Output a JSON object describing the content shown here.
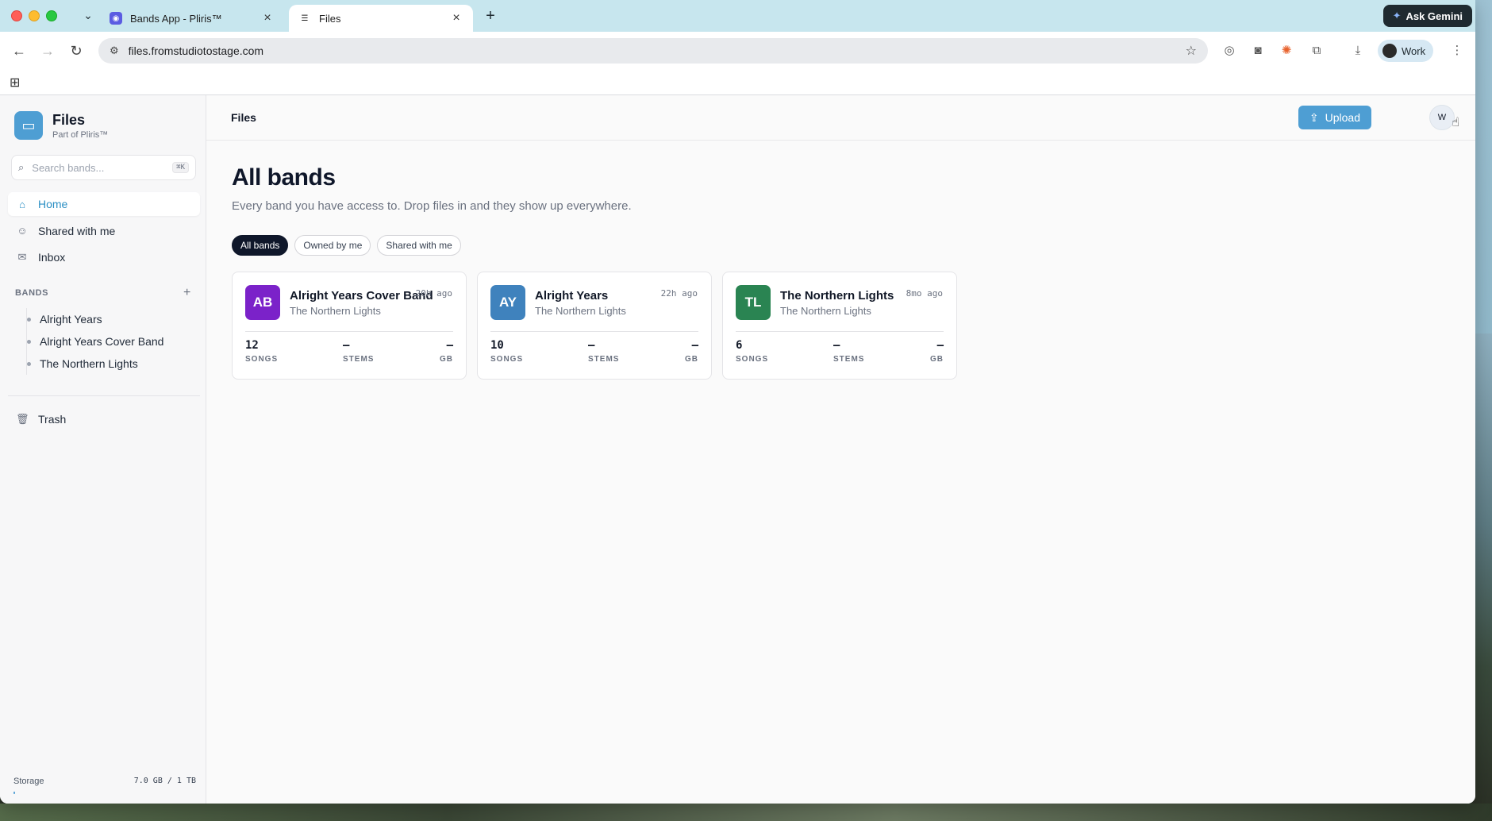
{
  "browser": {
    "tabs": [
      {
        "label": "Bands App - Pliris™"
      },
      {
        "label": "Files"
      }
    ],
    "ask_gemini": "Ask Gemini",
    "url": "files.fromstudiotostage.com",
    "profile": "Work"
  },
  "app": {
    "brand_name": "Files",
    "brand_sub": "Part of Pliris™",
    "search_placeholder": "Search bands...",
    "search_shortcut": "⌘K",
    "nav": [
      {
        "label": "Home"
      },
      {
        "label": "Shared with me"
      },
      {
        "label": "Inbox"
      }
    ],
    "bands_heading": "BANDS",
    "bands": [
      "Alright Years",
      "Alright Years Cover Band",
      "The Northern Lights"
    ],
    "trash": "Trash",
    "storage_label": "Storage",
    "storage_value": "7.0 GB / 1 TB",
    "storage_fraction": 0.007
  },
  "main": {
    "breadcrumb": "Files",
    "upload": "Upload",
    "avatar": "W",
    "title": "All bands",
    "subtitle": "Every band you have access to. Drop files in and they show up everywhere.",
    "filters": [
      "All bands",
      "Owned by me",
      "Shared with me"
    ],
    "cards": [
      {
        "initials": "AB",
        "name": "Alright Years Cover Band",
        "owner": "The Northern Lights",
        "ago": "20h ago",
        "color": "#7b22c9",
        "songs": "12",
        "stems": "–",
        "gb": "–",
        "songs_label": "SONGS",
        "stems_label": "STEMS",
        "gb_label": "GB"
      },
      {
        "initials": "AY",
        "name": "Alright Years",
        "owner": "The Northern Lights",
        "ago": "22h ago",
        "color": "#3f82bd",
        "songs": "10",
        "stems": "–",
        "gb": "–",
        "songs_label": "SONGS",
        "stems_label": "STEMS",
        "gb_label": "GB"
      },
      {
        "initials": "TL",
        "name": "The Northern Lights",
        "owner": "The Northern Lights",
        "ago": "8mo ago",
        "color": "#2a8452",
        "songs": "6",
        "stems": "–",
        "gb": "–",
        "songs_label": "SONGS",
        "stems_label": "STEMS",
        "gb_label": "GB"
      }
    ]
  }
}
